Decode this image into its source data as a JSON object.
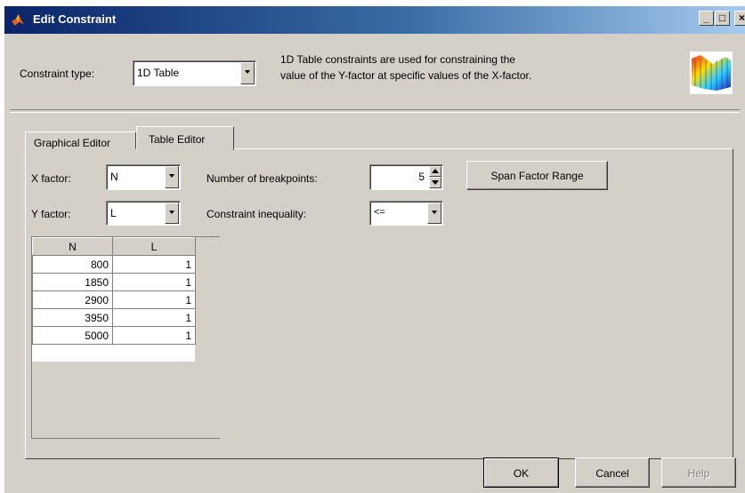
{
  "window": {
    "title": "Edit Constraint",
    "controls": [
      "_",
      "□",
      "×"
    ]
  },
  "header": {
    "constraint_type_label": "Constraint type:",
    "constraint_type_value": "1D Table",
    "description_line1": "1D Table constraints are used for constraining the",
    "description_line2": "value of the Y-factor at specific values of the X-factor."
  },
  "tabs": [
    {
      "label": "Graphical Editor"
    },
    {
      "label": "Table Editor"
    }
  ],
  "editor": {
    "x_factor_label": "X factor:",
    "x_factor_value": "N",
    "y_factor_label": "Y factor:",
    "y_factor_value": "L",
    "breakpoints_label": "Number of breakpoints:",
    "breakpoints_value": "5",
    "inequality_label": "Constraint inequality:",
    "inequality_value": "<=",
    "span_button": "Span Factor Range"
  },
  "table": {
    "columns": [
      "N",
      "L"
    ],
    "rows": [
      [
        "800",
        "1"
      ],
      [
        "1850",
        "1"
      ],
      [
        "2900",
        "1"
      ],
      [
        "3950",
        "1"
      ],
      [
        "5000",
        "1"
      ]
    ]
  },
  "footer": {
    "ok": "OK",
    "cancel": "Cancel",
    "help": "Help"
  }
}
